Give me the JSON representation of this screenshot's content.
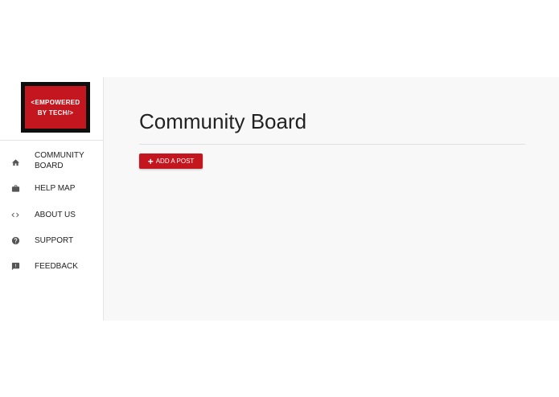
{
  "logo": {
    "line1": "<EMPOWERED",
    "line2": "BY TECH/>"
  },
  "sidebar": {
    "items": [
      {
        "label": "COMMUNITY BOARD",
        "icon": "home-icon"
      },
      {
        "label": "HELP MAP",
        "icon": "briefcase-icon"
      },
      {
        "label": "ABOUT US",
        "icon": "code-icon"
      },
      {
        "label": "SUPPORT",
        "icon": "help-circle-icon"
      },
      {
        "label": "FEEDBACK",
        "icon": "feedback-icon"
      }
    ]
  },
  "main": {
    "title": "Community Board",
    "add_button_label": "ADD A POST"
  },
  "colors": {
    "brand_red": "#c4161f",
    "logo_border": "#0e0e0e",
    "main_background": "#f8f8f8"
  }
}
